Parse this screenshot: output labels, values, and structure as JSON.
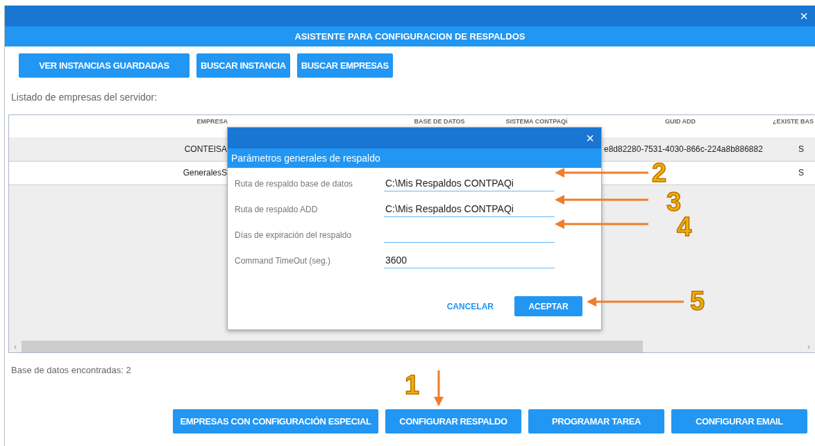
{
  "window": {
    "close": "×",
    "title": "ASISTENTE PARA CONFIGURACION DE RESPALDOS"
  },
  "top_buttons": [
    "VER INSTANCIAS GUARDADAS",
    "BUSCAR INSTANCIA",
    "BUSCAR EMPRESAS"
  ],
  "list_label": "Listado de empresas del servidor:",
  "table": {
    "columns": [
      "EMPRESA",
      "",
      "BASE DE DATOS",
      "SISTEMA CONTPAQi",
      "GUID ADD",
      "¿EXISTE BAS"
    ],
    "rows": [
      [
        "CONTEISA",
        "",
        "",
        "",
        "e8d82280-7531-4030-866c-224a8b886882",
        "S"
      ],
      [
        "GeneralesS",
        "",
        "",
        "",
        "",
        "S"
      ]
    ]
  },
  "scrollbar": {
    "left": "‹",
    "right": "›"
  },
  "found_label": "Base de datos encontradas: 2",
  "bottom_buttons": [
    "EMPRESAS CON CONFIGURACIÓN ESPECIAL",
    "CONFIGURAR RESPALDO",
    "PROGRAMAR TAREA",
    "CONFIGURAR EMAIL"
  ],
  "dialog": {
    "close": "×",
    "title": "Parámetros generales de respaldo",
    "fields": [
      {
        "label": "Ruta de respaldo base de datos",
        "value": "C:\\Mis Respaldos CONTPAQi"
      },
      {
        "label": "Ruta de respaldo ADD",
        "value": "C:\\Mis Respaldos CONTPAQi"
      },
      {
        "label": "Días de expiración del respaldo"
      },
      {
        "label": "Command TimeOut (seg.)",
        "value": "3600"
      }
    ],
    "cancel": "CANCELAR",
    "accept": "ACEPTAR"
  },
  "annotations": [
    "2",
    "3",
    "4",
    "5",
    "1"
  ]
}
